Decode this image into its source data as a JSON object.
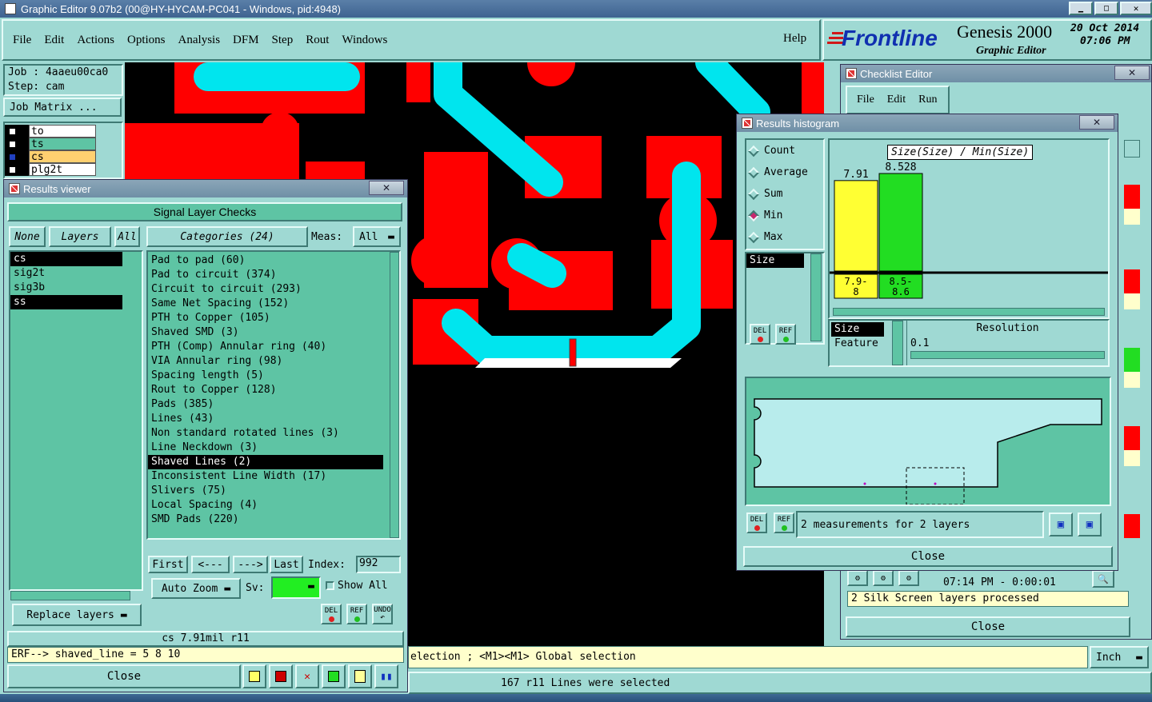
{
  "app": {
    "title": "Graphic Editor 9.07b2 (00@HY-HYCAM-PC041 - Windows, pid:4948)"
  },
  "menu": {
    "items": [
      "File",
      "Edit",
      "Actions",
      "Options",
      "Analysis",
      "DFM",
      "Step",
      "Rout",
      "Windows"
    ],
    "help": "Help"
  },
  "brand": {
    "logo": "Frontline",
    "product": "Genesis 2000",
    "subtitle": "Graphic Editor",
    "date": "20 Oct 2014",
    "time": "07:06 PM"
  },
  "job": {
    "job_label": "Job : 4aaeu00ca0",
    "step_label": "Step: cam",
    "matrix_button": "Job Matrix ..."
  },
  "layers": [
    {
      "name": "to"
    },
    {
      "name": "ts"
    },
    {
      "name": "cs"
    },
    {
      "name": "plg2t"
    }
  ],
  "results_viewer": {
    "title": "Results viewer",
    "header": "Signal Layer Checks",
    "none_btn": "None",
    "layers_btn": "Layers",
    "all_btn": "All",
    "categories_btn": "Categories (24)",
    "meas_label": "Meas:",
    "meas_value": "All",
    "layer_list": [
      "cs",
      "sig2t",
      "sig3b",
      "ss"
    ],
    "categories": [
      "Pad to pad (60)",
      "Pad to circuit (374)",
      "Circuit to circuit (293)",
      "Same Net Spacing (152)",
      "PTH to Copper (105)",
      "Shaved SMD (3)",
      "PTH (Comp) Annular ring (40)",
      "VIA Annular ring (98)",
      "Spacing length (5)",
      "Rout to Copper (128)",
      "Pads (385)",
      "Lines (43)",
      "Non standard rotated lines (3)",
      "Line Neckdown (3)",
      "Shaved Lines (2)",
      "Inconsistent Line Width (17)",
      "Slivers (75)",
      "Local Spacing (4)",
      "SMD Pads (220)"
    ],
    "nav": {
      "first": "First",
      "prev": "<---",
      "next": "--->",
      "last": "Last",
      "index_label": "Index:",
      "index_value": "992"
    },
    "auto_zoom": "Auto Zoom",
    "sv_label": "Sv:",
    "show_all": "Show All",
    "replace_layers": "Replace layers",
    "del": "DEL",
    "ref": "REF",
    "undo": "UNDO",
    "measure_status": "cs 7.91mil   r11",
    "erf": "ERF--> shaved_line = 5 8 10",
    "close": "Close"
  },
  "histogram": {
    "title": "Results histogram",
    "options": [
      "Count",
      "Average",
      "Sum",
      "Min",
      "Max"
    ],
    "selected": "Min",
    "chart_title": "Size(Size) / Min(Size)",
    "size_list": [
      "Size"
    ],
    "group_list": [
      "Size",
      "Feature"
    ],
    "resolution_label": "Resolution",
    "resolution_value": "0.1",
    "del": "DEL",
    "ref": "REF",
    "summary": "2 measurements for 2 layers",
    "close": "Close",
    "bars": [
      {
        "value_label": "7.91",
        "range": "7.9-8",
        "color": "#ffff33"
      },
      {
        "value_label": "8.528",
        "range": "8.5-8.6",
        "color": "#22dd22"
      }
    ]
  },
  "chart_data": {
    "type": "bar",
    "title": "Size(Size) / Min(Size)",
    "categories": [
      "7.9-8",
      "8.5-8.6"
    ],
    "values": [
      7.91,
      8.528
    ]
  },
  "checklist": {
    "title": "Checklist Editor",
    "menu": [
      "File",
      "Edit",
      "Run"
    ],
    "time_row": "07:14 PM - 0:00:01",
    "status": "2 Silk Screen layers processed",
    "close": "Close"
  },
  "status": {
    "hint": "election ; <M1><M1> Global selection",
    "units": "Inch",
    "message": "167 r11 Lines were selected"
  },
  "colors": {
    "panel": "#9fd9d3",
    "panel_dark": "#5ec4a4",
    "copper": "#ff0000",
    "trace": "#00e5ee"
  }
}
